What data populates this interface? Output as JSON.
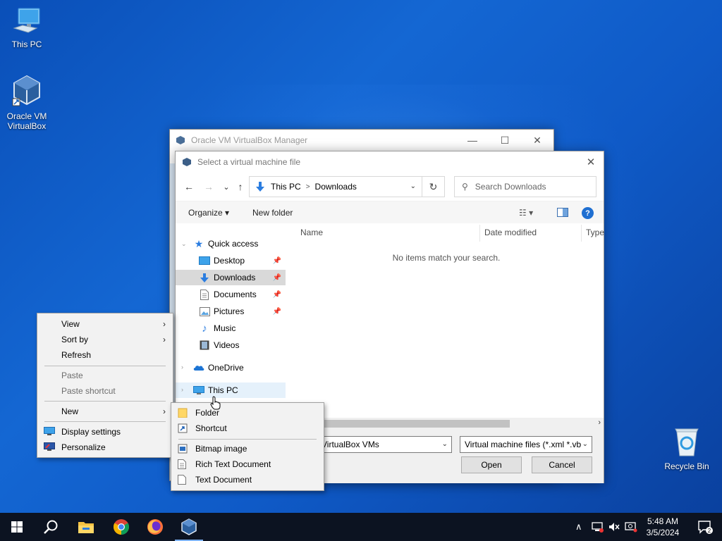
{
  "desktop": {
    "icons": [
      {
        "label": "This PC"
      },
      {
        "label": "Oracle VM VirtualBox"
      },
      {
        "label": "Recycle Bin"
      }
    ]
  },
  "vbox_manager": {
    "title": "Oracle VM VirtualBox Manager",
    "minimize": "—",
    "maximize": "☐",
    "close": "✕"
  },
  "dialog": {
    "title": "Select a virtual machine file",
    "close": "✕",
    "nav": {
      "back": "←",
      "forward": "→",
      "recent": "⌄",
      "up": "↑",
      "refresh": "↻"
    },
    "address": {
      "segments": [
        "This PC",
        "Downloads"
      ]
    },
    "search": {
      "placeholder": "Search Downloads"
    },
    "toolbar": {
      "organize": "Organize ▾",
      "new_folder": "New folder",
      "view": "☷ ▾",
      "help": "?"
    },
    "nav_pane": {
      "quick_access": "Quick access",
      "items": [
        {
          "label": "Desktop",
          "pinned": true
        },
        {
          "label": "Downloads",
          "pinned": true
        },
        {
          "label": "Documents",
          "pinned": true
        },
        {
          "label": "Pictures",
          "pinned": true
        },
        {
          "label": "Music"
        },
        {
          "label": "Videos"
        }
      ],
      "onedrive": "OneDrive",
      "this_pc": "This PC"
    },
    "columns": [
      "Name",
      "Date modified",
      "Type"
    ],
    "empty_message": "No items match your search.",
    "file_name_value": "VirtualBox VMs",
    "file_type_value": "Virtual machine files (*.xml *.vb",
    "open_label": "Open",
    "cancel_label": "Cancel"
  },
  "context_menu": {
    "items": [
      {
        "label": "View",
        "submenu": true
      },
      {
        "label": "Sort by",
        "submenu": true
      },
      {
        "label": "Refresh"
      },
      {
        "label": "Paste",
        "disabled": true
      },
      {
        "label": "Paste shortcut",
        "disabled": true
      },
      {
        "label": "New",
        "submenu": true
      },
      {
        "label": "Display settings"
      },
      {
        "label": "Personalize"
      }
    ]
  },
  "new_submenu": {
    "items": [
      {
        "label": "Folder"
      },
      {
        "label": "Shortcut"
      },
      {
        "label": "Bitmap image"
      },
      {
        "label": "Rich Text Document"
      },
      {
        "label": "Text Document"
      }
    ]
  },
  "taskbar": {
    "time": "5:48 AM",
    "date": "3/5/2024",
    "notification_count": "2",
    "icons": [
      "windows-start-icon",
      "search-icon",
      "file-explorer-icon",
      "chrome-icon",
      "firefox-icon",
      "virtualbox-icon"
    ]
  },
  "colors": {
    "accent": "#1f6fd1",
    "taskbar": "#0c1321",
    "desktop": "#1467d3"
  }
}
